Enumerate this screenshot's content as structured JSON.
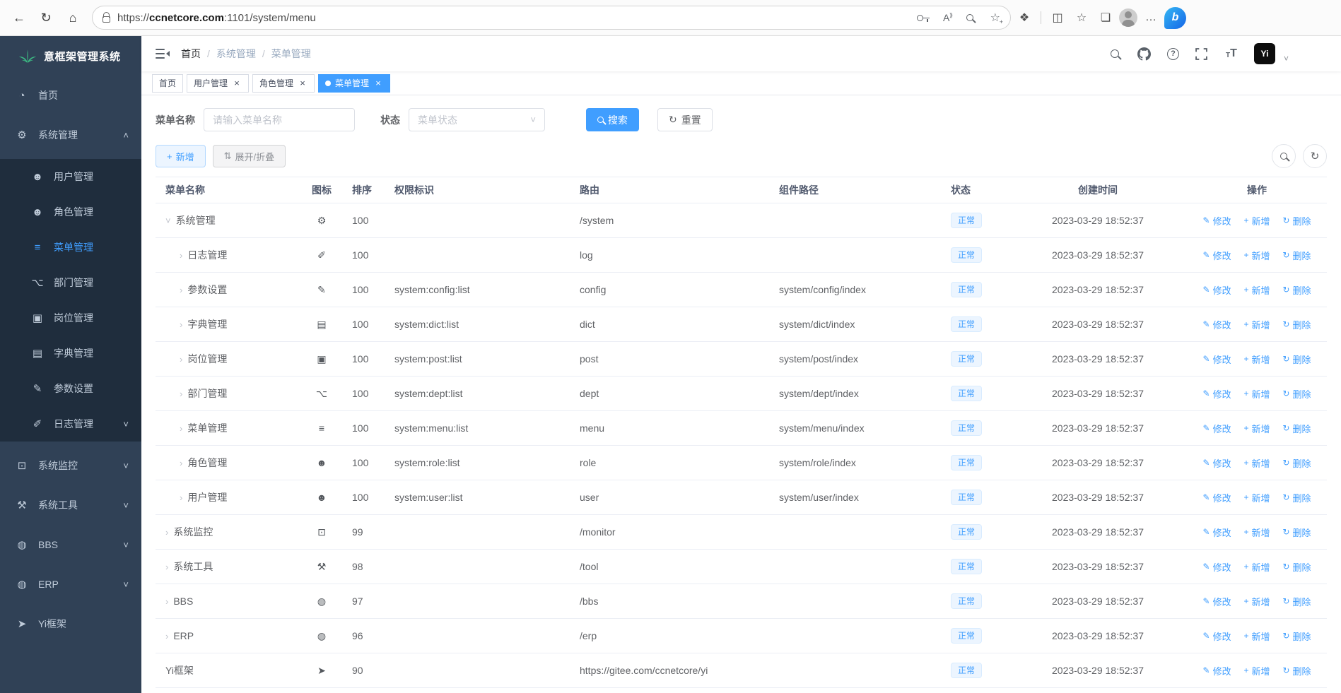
{
  "browser": {
    "url": {
      "scheme": "https://",
      "host": "ccnetcore.com",
      "path": ":1101/system/menu"
    }
  },
  "app": {
    "title": "意框架管理系统",
    "breadcrumb": [
      "首页",
      "系统管理",
      "菜单管理"
    ]
  },
  "sidebar": {
    "items": [
      {
        "label": "首页",
        "icon": "dashboard",
        "chevron": "",
        "submenu": false,
        "active": false
      },
      {
        "label": "系统管理",
        "icon": "gear",
        "chevron": "chevron-up",
        "submenu": false,
        "active": false
      },
      {
        "label": "用户管理",
        "icon": "user",
        "chevron": "",
        "submenu": true,
        "active": false
      },
      {
        "label": "角色管理",
        "icon": "users",
        "chevron": "",
        "submenu": true,
        "active": false
      },
      {
        "label": "菜单管理",
        "icon": "menu",
        "chevron": "",
        "submenu": true,
        "active": true
      },
      {
        "label": "部门管理",
        "icon": "tree",
        "chevron": "",
        "submenu": true,
        "active": false
      },
      {
        "label": "岗位管理",
        "icon": "badge",
        "chevron": "",
        "submenu": true,
        "active": false
      },
      {
        "label": "字典管理",
        "icon": "book",
        "chevron": "",
        "submenu": true,
        "active": false
      },
      {
        "label": "参数设置",
        "icon": "edit",
        "chevron": "",
        "submenu": true,
        "active": false
      },
      {
        "label": "日志管理",
        "icon": "log",
        "chevron": "chevron-down",
        "submenu": true,
        "active": false
      },
      {
        "label": "系统监控",
        "icon": "monitor",
        "chevron": "chevron-down",
        "submenu": false,
        "active": false
      },
      {
        "label": "系统工具",
        "icon": "tool",
        "chevron": "chevron-down",
        "submenu": false,
        "active": false
      },
      {
        "label": "BBS",
        "icon": "globe",
        "chevron": "chevron-down",
        "submenu": false,
        "active": false
      },
      {
        "label": "ERP",
        "icon": "globe",
        "chevron": "chevron-down",
        "submenu": false,
        "active": false
      },
      {
        "label": "Yi框架",
        "icon": "send",
        "chevron": "",
        "submenu": false,
        "active": false
      }
    ]
  },
  "tabs": [
    {
      "label": "首页",
      "closable": false,
      "active": false
    },
    {
      "label": "用户管理",
      "closable": true,
      "active": false
    },
    {
      "label": "角色管理",
      "closable": true,
      "active": false
    },
    {
      "label": "菜单管理",
      "closable": true,
      "active": true
    }
  ],
  "filters": {
    "menu_name_label": "菜单名称",
    "menu_name_placeholder": "请输入菜单名称",
    "status_label": "状态",
    "status_placeholder": "菜单状态",
    "search_label": "搜索",
    "reset_label": "重置"
  },
  "toolbar": {
    "add_label": "新增",
    "toggle_label": "展开/折叠"
  },
  "table": {
    "headers": [
      "菜单名称",
      "图标",
      "排序",
      "权限标识",
      "路由",
      "组件路径",
      "状态",
      "创建时间",
      "操作"
    ],
    "actions": {
      "edit": "修改",
      "add": "新增",
      "remove": "删除"
    },
    "rows": [
      {
        "name": "系统管理",
        "arrow": "caret-open",
        "icon": "gear",
        "sort": "100",
        "perms": "",
        "route": "/system",
        "component": "",
        "status": "正常",
        "time": "2023-03-29 18:52:37",
        "child": false
      },
      {
        "name": "日志管理",
        "arrow": "caret-closed",
        "icon": "log",
        "sort": "100",
        "perms": "",
        "route": "log",
        "component": "",
        "status": "正常",
        "time": "2023-03-29 18:52:37",
        "child": true
      },
      {
        "name": "参数设置",
        "arrow": "caret-closed",
        "icon": "edit",
        "sort": "100",
        "perms": "system:config:list",
        "route": "config",
        "component": "system/config/index",
        "status": "正常",
        "time": "2023-03-29 18:52:37",
        "child": true
      },
      {
        "name": "字典管理",
        "arrow": "caret-closed",
        "icon": "book",
        "sort": "100",
        "perms": "system:dict:list",
        "route": "dict",
        "component": "system/dict/index",
        "status": "正常",
        "time": "2023-03-29 18:52:37",
        "child": true
      },
      {
        "name": "岗位管理",
        "arrow": "caret-closed",
        "icon": "badge",
        "sort": "100",
        "perms": "system:post:list",
        "route": "post",
        "component": "system/post/index",
        "status": "正常",
        "time": "2023-03-29 18:52:37",
        "child": true
      },
      {
        "name": "部门管理",
        "arrow": "caret-closed",
        "icon": "tree",
        "sort": "100",
        "perms": "system:dept:list",
        "route": "dept",
        "component": "system/dept/index",
        "status": "正常",
        "time": "2023-03-29 18:52:37",
        "child": true
      },
      {
        "name": "菜单管理",
        "arrow": "caret-closed",
        "icon": "menu",
        "sort": "100",
        "perms": "system:menu:list",
        "route": "menu",
        "component": "system/menu/index",
        "status": "正常",
        "time": "2023-03-29 18:52:37",
        "child": true
      },
      {
        "name": "角色管理",
        "arrow": "caret-closed",
        "icon": "users",
        "sort": "100",
        "perms": "system:role:list",
        "route": "role",
        "component": "system/role/index",
        "status": "正常",
        "time": "2023-03-29 18:52:37",
        "child": true
      },
      {
        "name": "用户管理",
        "arrow": "caret-closed",
        "icon": "user",
        "sort": "100",
        "perms": "system:user:list",
        "route": "user",
        "component": "system/user/index",
        "status": "正常",
        "time": "2023-03-29 18:52:37",
        "child": true
      },
      {
        "name": "系统监控",
        "arrow": "caret-closed",
        "icon": "monitor",
        "sort": "99",
        "perms": "",
        "route": "/monitor",
        "component": "",
        "status": "正常",
        "time": "2023-03-29 18:52:37",
        "child": false
      },
      {
        "name": "系统工具",
        "arrow": "caret-closed",
        "icon": "tool",
        "sort": "98",
        "perms": "",
        "route": "/tool",
        "component": "",
        "status": "正常",
        "time": "2023-03-29 18:52:37",
        "child": false
      },
      {
        "name": "BBS",
        "arrow": "caret-closed",
        "icon": "globe",
        "sort": "97",
        "perms": "",
        "route": "/bbs",
        "component": "",
        "status": "正常",
        "time": "2023-03-29 18:52:37",
        "child": false
      },
      {
        "name": "ERP",
        "arrow": "caret-closed",
        "icon": "globe",
        "sort": "96",
        "perms": "",
        "route": "/erp",
        "component": "",
        "status": "正常",
        "time": "2023-03-29 18:52:37",
        "child": false
      },
      {
        "name": "Yi框架",
        "arrow": "",
        "icon": "send",
        "sort": "90",
        "perms": "",
        "route": "https://gitee.com/ccnetcore/yi",
        "component": "",
        "status": "正常",
        "time": "2023-03-29 18:52:37",
        "child": false
      }
    ]
  },
  "icons": {
    "chevron-up": "˄",
    "chevron-down": "˅",
    "caret-open": "˅",
    "caret-closed": "›",
    "dashboard": "◔",
    "gear": "⚙",
    "user": "☻",
    "users": "☻",
    "menu": "≡",
    "tree": "⌥",
    "badge": "▣",
    "book": "▤",
    "edit": "✎",
    "log": "✐",
    "monitor": "⊡",
    "tool": "⚒",
    "globe": "◍",
    "send": "➤",
    "plus": "+",
    "sort": "⇅",
    "refresh": "↻",
    "back": "←",
    "home": "⌂",
    "star": "☆",
    "extensions": "❖",
    "split": "◫",
    "collections": "❏",
    "more": "…"
  },
  "colors": {
    "accent": "#409eff",
    "sidebar_bg": "#304156",
    "sidebar_submenu_bg": "#1f2d3d",
    "badge_bg": "#ecf5ff",
    "badge_text": "#409eff",
    "logo_green": "#3cba83"
  }
}
